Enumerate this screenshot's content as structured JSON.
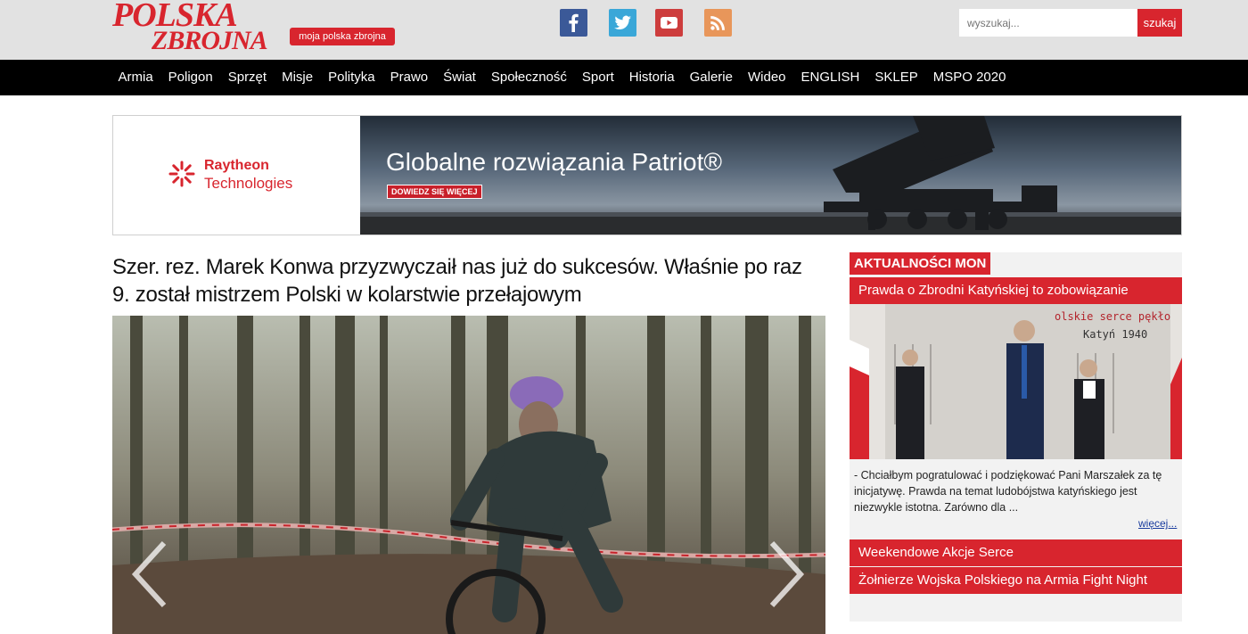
{
  "header": {
    "logo_line1": "POLSKA",
    "logo_line2": "ZBROJNA",
    "moja_label": "moja polska zbrojna",
    "social": [
      {
        "icon": "facebook-icon",
        "color": "#3b5998"
      },
      {
        "icon": "twitter-icon",
        "color": "#3aa7d8"
      },
      {
        "icon": "youtube-icon",
        "color": "#cd3d3d"
      },
      {
        "icon": "rss-icon",
        "color": "#e8965a"
      }
    ],
    "search_placeholder": "wyszukaj...",
    "search_button": "szukaj"
  },
  "nav": {
    "items": [
      "Armia",
      "Poligon",
      "Sprzęt",
      "Misje",
      "Polityka",
      "Prawo",
      "Świat",
      "Społeczność",
      "Sport",
      "Historia",
      "Galerie",
      "Wideo",
      "ENGLISH",
      "SKLEP",
      "MSPO 2020"
    ]
  },
  "banner": {
    "brand_name": "Raytheon",
    "brand_sub": "Technologies",
    "headline": "Globalne rozwiązania Patriot®",
    "cta": "DOWIEDZ SIĘ WIĘCEJ"
  },
  "article": {
    "title": "Szer. rez. Marek Konwa przyzwyczaił nas już do sukcesów. Właśnie po raz 9. został mistrzem Polski w kolarstwie przełajowym"
  },
  "sidebar": {
    "header": "AKTUALNOŚCI MON",
    "items": [
      "Prawda o Zbrodni Katyńskiej to zobowiązanie",
      "Weekendowe Akcje Serce",
      "Żołnierze Wojska Polskiego na Armia Fight Night"
    ],
    "photo_caption_line1": "olskie serce pękło",
    "photo_caption_line2": "Katyń 1940",
    "excerpt": "- Chciałbym pogratulować i podziękować Pani Marszałek za tę inicjatywę. Prawda na temat ludobójstwa katyńskiego jest niezwykle istotna. Zarówno dla ...",
    "more": "więcej..."
  },
  "colors": {
    "brand_red": "#d8252e",
    "nav_bg": "#000000",
    "topbar_bg": "#e2e2e2"
  }
}
